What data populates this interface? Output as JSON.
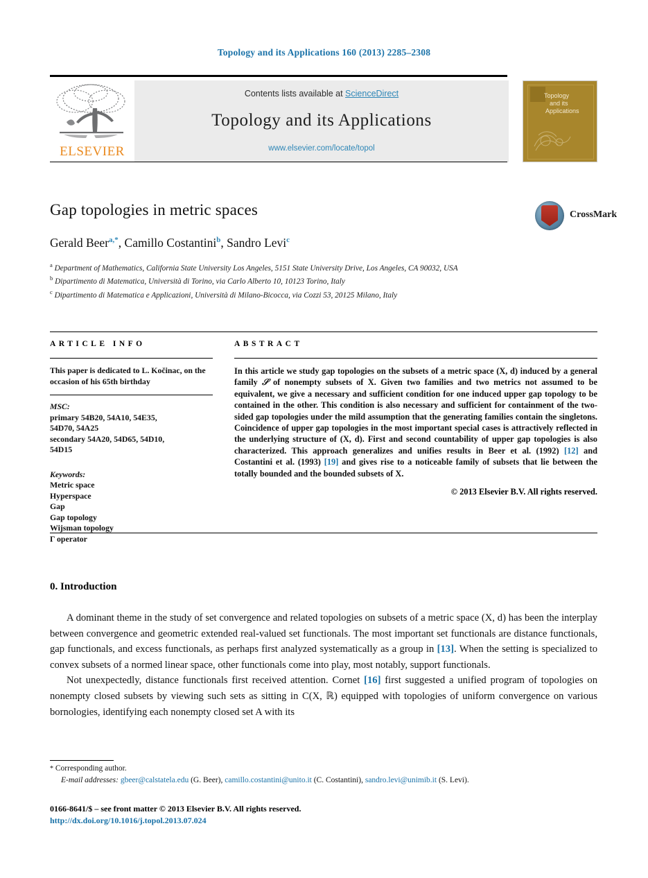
{
  "running_head": "Topology and its Applications 160 (2013) 2285–2308",
  "masthead": {
    "contents_prefix": "Contents lists available at ",
    "sciencedirect": "ScienceDirect",
    "journal_title": "Topology and its Applications",
    "journal_url": "www.elsevier.com/locate/topol",
    "publisher_logo_text": "ELSEVIER",
    "cover": {
      "line1": "Topology",
      "line2": "and its",
      "line3": "Applications"
    }
  },
  "article": {
    "title": "Gap topologies in metric spaces",
    "crossmark_label": "CrossMark",
    "authors": [
      {
        "name": "Gerald Beer",
        "marks": "a,*"
      },
      {
        "name": "Camillo Costantini",
        "marks": "b"
      },
      {
        "name": "Sandro Levi",
        "marks": "c"
      }
    ],
    "affiliations": [
      {
        "mark": "a",
        "text": "Department of Mathematics, California State University Los Angeles, 5151 State University Drive, Los Angeles, CA 90032, USA"
      },
      {
        "mark": "b",
        "text": "Dipartimento di Matematica, Università di Torino, via Carlo Alberto 10, 10123 Torino, Italy"
      },
      {
        "mark": "c",
        "text": "Dipartimento di Matematica e Applicazioni, Università di Milano-Bicocca, via Cozzi 53, 20125 Milano, Italy"
      }
    ]
  },
  "info": {
    "label": "ARTICLE INFO",
    "dedication": "This paper is dedicated to L. Kočinac, on the occasion of his 65th birthday",
    "msc_heading": "MSC:",
    "msc_lines": [
      "primary 54B20, 54A10, 54E35,",
      "54D70, 54A25",
      "secondary 54A20, 54D65, 54D10,",
      "54D15"
    ],
    "keywords_heading": "Keywords:",
    "keywords": [
      "Metric space",
      "Hyperspace",
      "Gap",
      "Gap topology",
      "Wijsman topology",
      "Γ operator"
    ]
  },
  "abstract": {
    "label": "ABSTRACT",
    "part1": "In this article we study gap topologies on the subsets of a metric space (X, d) induced by a general family ",
    "family_symbol": "𝒮",
    "part2": " of nonempty subsets of X. Given two families and two metrics not assumed to be equivalent, we give a necessary and sufficient condition for one induced upper gap topology to be contained in the other. This condition is also necessary and sufficient for containment of the two-sided gap topologies under the mild assumption that the generating families contain the singletons. Coincidence of upper gap topologies in the most important special cases is attractively reflected in the underlying structure of (X, d). First and second countability of upper gap topologies is also characterized. This approach generalizes and unifies results in Beer et al. (1992) ",
    "cite1": "[12]",
    "part3": " and Costantini et al. (1993) ",
    "cite2": "[19]",
    "part4": " and gives rise to a noticeable family of subsets that lie between the totally bounded and the bounded subsets of X.",
    "copyright": "© 2013 Elsevier B.V. All rights reserved."
  },
  "body": {
    "section_title": "0. Introduction",
    "para1_a": "A dominant theme in the study of set convergence and related topologies on subsets of a metric space (X, d) has been the interplay between convergence and geometric extended real-valued set functionals. The most important set functionals are distance functionals, gap functionals, and excess functionals, as perhaps first analyzed systematically as a group in ",
    "para1_cite": "[13]",
    "para1_b": ". When the setting is specialized to convex subsets of a normed linear space, other functionals come into play, most notably, support functionals.",
    "para2_a": "Not unexpectedly, distance functionals first received attention. Cornet ",
    "para2_cite": "[16]",
    "para2_b": " first suggested a unified program of topologies on nonempty closed subsets by viewing such sets as sitting in C(X, ℝ) equipped with topologies of uniform convergence on various bornologies, identifying each nonempty closed set A with its"
  },
  "footnotes": {
    "corresponding": "Corresponding author.",
    "email_label": "E-mail addresses:",
    "emails": [
      {
        "address": "gbeer@calstatela.edu",
        "owner": "(G. Beer),"
      },
      {
        "address": "camillo.costantini@unito.it",
        "owner": "(C. Costantini),"
      },
      {
        "address": "sandro.levi@unimib.it",
        "owner": ""
      }
    ],
    "trailing_owner": "(S. Levi)."
  },
  "bottom": {
    "issn_line": "0166-8641/$ – see front matter  © 2013 Elsevier B.V. All rights reserved.",
    "doi": "http://dx.doi.org/10.1016/j.topol.2013.07.024"
  },
  "colors": {
    "link": "#1a72a8",
    "sciencedirect": "#2f87b7",
    "elsevier_orange": "#ea8a1f",
    "cover_bg": "#a8862c"
  }
}
